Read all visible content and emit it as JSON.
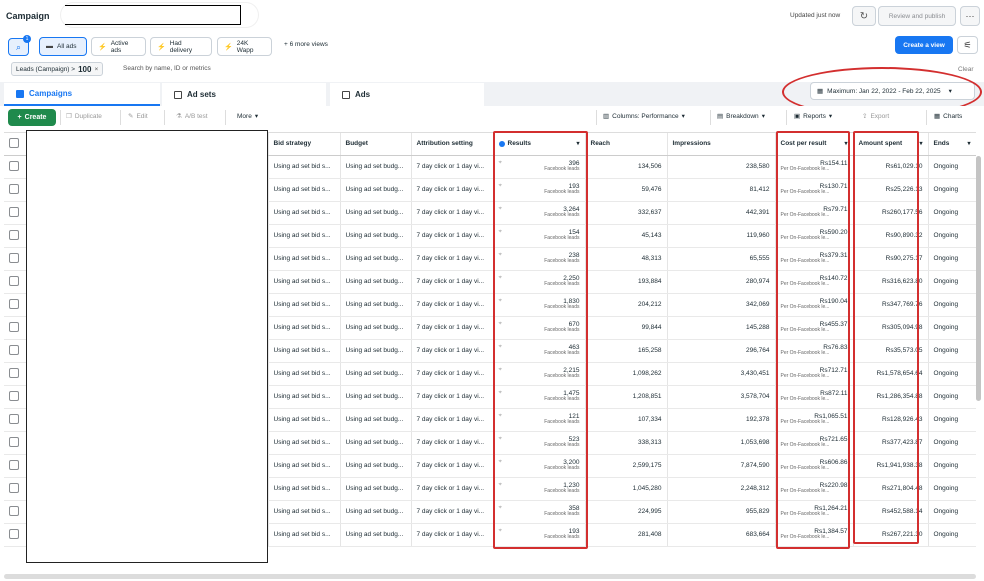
{
  "header": {
    "title": "Campaign",
    "updated": "Updated just now",
    "publish_label": "Review and publish",
    "refresh_icon": "refresh-icon",
    "more_icon": "more-icon"
  },
  "views": {
    "search_badge": "1",
    "items": [
      {
        "label": "All ads"
      },
      {
        "label": "Active ads"
      },
      {
        "label": "Had delivery"
      },
      {
        "label": "24K Wapp"
      }
    ],
    "more_label": "+ 6 more views",
    "create_view_label": "Create a view"
  },
  "filter": {
    "tag_label": "Leads (Campaign) >",
    "tag_value": "100",
    "search_placeholder": "Search by name, ID or metrics",
    "clear_label": "Clear"
  },
  "tabs": {
    "campaigns": "Campaigns",
    "adsets": "Ad sets",
    "ads": "Ads"
  },
  "date_range": "Maximum: Jan 22, 2022 - Feb 22, 2025",
  "toolbar": {
    "create": "Create",
    "duplicate": "Duplicate",
    "edit": "Edit",
    "ab_test": "A/B test",
    "more": "More",
    "columns": "Columns: Performance",
    "breakdown": "Breakdown",
    "reports": "Reports",
    "export": "Export",
    "charts": "Charts"
  },
  "columns": {
    "bid_strategy": "Bid strategy",
    "budget": "Budget",
    "attribution": "Attribution setting",
    "results": "Results",
    "reach": "Reach",
    "impressions": "Impressions",
    "cost_per_result": "Cost per result",
    "amount_spent": "Amount spent",
    "ends": "Ends"
  },
  "row_common": {
    "bid": "Using ad set bid s...",
    "budget": "Using ad set budg...",
    "attribution": "7 day click or 1 day vi...",
    "result_type": "Facebook leads",
    "cost_type": "Per On-Facebook le...",
    "ends": "Ongoing"
  },
  "rows": [
    {
      "results": "396",
      "reach": "134,506",
      "impressions": "238,580",
      "cpr": "Rs154.11",
      "spent": "Rs61,029.10"
    },
    {
      "results": "193",
      "reach": "59,476",
      "impressions": "81,412",
      "cpr": "Rs130.71",
      "spent": "Rs25,226.13"
    },
    {
      "results": "3,264",
      "reach": "332,637",
      "impressions": "442,391",
      "cpr": "Rs79.71",
      "spent": "Rs260,177.56"
    },
    {
      "results": "154",
      "reach": "45,143",
      "impressions": "119,960",
      "cpr": "Rs590.20",
      "spent": "Rs90,890.32"
    },
    {
      "results": "238",
      "reach": "48,313",
      "impressions": "65,555",
      "cpr": "Rs379.31",
      "spent": "Rs90,275.17"
    },
    {
      "results": "2,250",
      "reach": "193,884",
      "impressions": "280,974",
      "cpr": "Rs140.72",
      "spent": "Rs316,623.80"
    },
    {
      "results": "1,830",
      "reach": "204,212",
      "impressions": "342,069",
      "cpr": "Rs190.04",
      "spent": "Rs347,769.76"
    },
    {
      "results": "670",
      "reach": "99,844",
      "impressions": "145,288",
      "cpr": "Rs455.37",
      "spent": "Rs305,094.98"
    },
    {
      "results": "463",
      "reach": "165,258",
      "impressions": "296,764",
      "cpr": "Rs76.83",
      "spent": "Rs35,573.05"
    },
    {
      "results": "2,215",
      "reach": "1,098,262",
      "impressions": "3,430,451",
      "cpr": "Rs712.71",
      "spent": "Rs1,578,654.64"
    },
    {
      "results": "1,475",
      "reach": "1,208,851",
      "impressions": "3,578,704",
      "cpr": "Rs872.11",
      "spent": "Rs1,286,354.88"
    },
    {
      "results": "121",
      "reach": "107,334",
      "impressions": "192,378",
      "cpr": "Rs1,065.51",
      "spent": "Rs128,926.43"
    },
    {
      "results": "523",
      "reach": "338,313",
      "impressions": "1,053,698",
      "cpr": "Rs721.65",
      "spent": "Rs377,423.87"
    },
    {
      "results": "3,200",
      "reach": "2,599,175",
      "impressions": "7,874,590",
      "cpr": "Rs606.86",
      "spent": "Rs1,941,938.38"
    },
    {
      "results": "1,230",
      "reach": "1,045,280",
      "impressions": "2,248,312",
      "cpr": "Rs220.98",
      "spent": "Rs271,804.48"
    },
    {
      "results": "358",
      "reach": "224,995",
      "impressions": "955,829",
      "cpr": "Rs1,264.21",
      "spent": "Rs452,588.14"
    },
    {
      "results": "193",
      "reach": "281,408",
      "impressions": "683,664",
      "cpr": "Rs1,384.57",
      "spent": "Rs267,221.30"
    }
  ],
  "colors": {
    "primary": "#1877f2",
    "create_green": "#1f8a4c",
    "annotation_red": "#d32f2f"
  }
}
